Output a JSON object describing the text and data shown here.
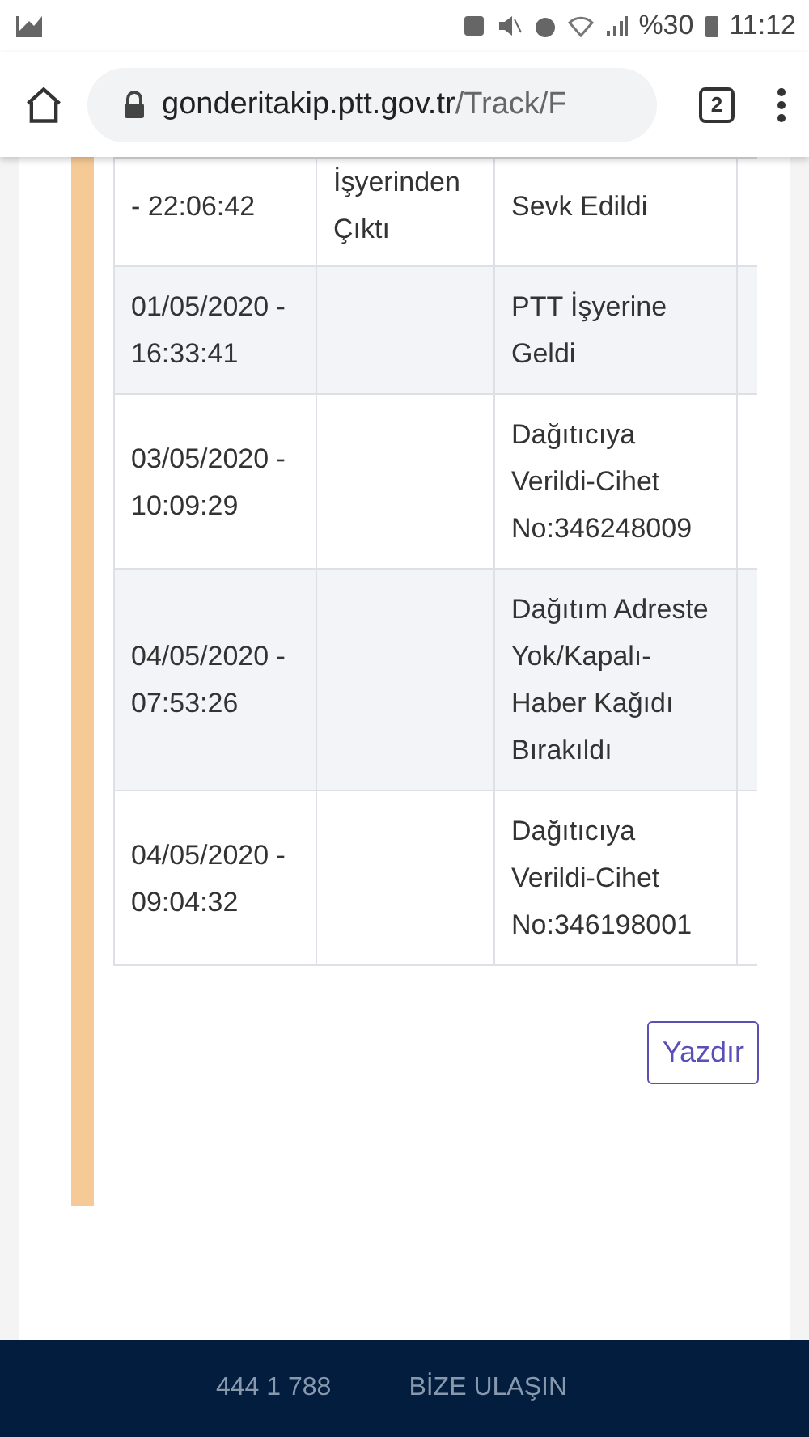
{
  "status_bar": {
    "battery_percent": "%30",
    "time": "11:12"
  },
  "browser": {
    "url_host": "gonderitakip.ptt.gov.tr",
    "url_path": "/Track/F",
    "tab_count": "2"
  },
  "table": {
    "rows": [
      {
        "date": "- 22:06:42",
        "place": "İşyerinden Çıktı",
        "status": "Sevk Edildi",
        "shaded": false,
        "partial": true
      },
      {
        "date": "01/05/2020 - 16:33:41",
        "place": "",
        "status": "PTT İşyerine Geldi",
        "shaded": true,
        "partial": false
      },
      {
        "date": "03/05/2020 - 10:09:29",
        "place": "",
        "status": "Dağıtıcıya Verildi-Cihet No:346248009",
        "shaded": false,
        "partial": false
      },
      {
        "date": "04/05/2020 - 07:53:26",
        "place": "",
        "status": "Dağıtım Adreste Yok/Kapalı-Haber Kağıdı Bırakıldı",
        "shaded": true,
        "partial": false
      },
      {
        "date": "04/05/2020 - 09:04:32",
        "place": "",
        "status": "Dağıtıcıya Verildi-Cihet No:346198001",
        "shaded": false,
        "partial": false
      }
    ]
  },
  "print_button": "Yazdır",
  "footer": {
    "phone": "444 1 788",
    "contact": "BİZE ULAŞIN"
  }
}
